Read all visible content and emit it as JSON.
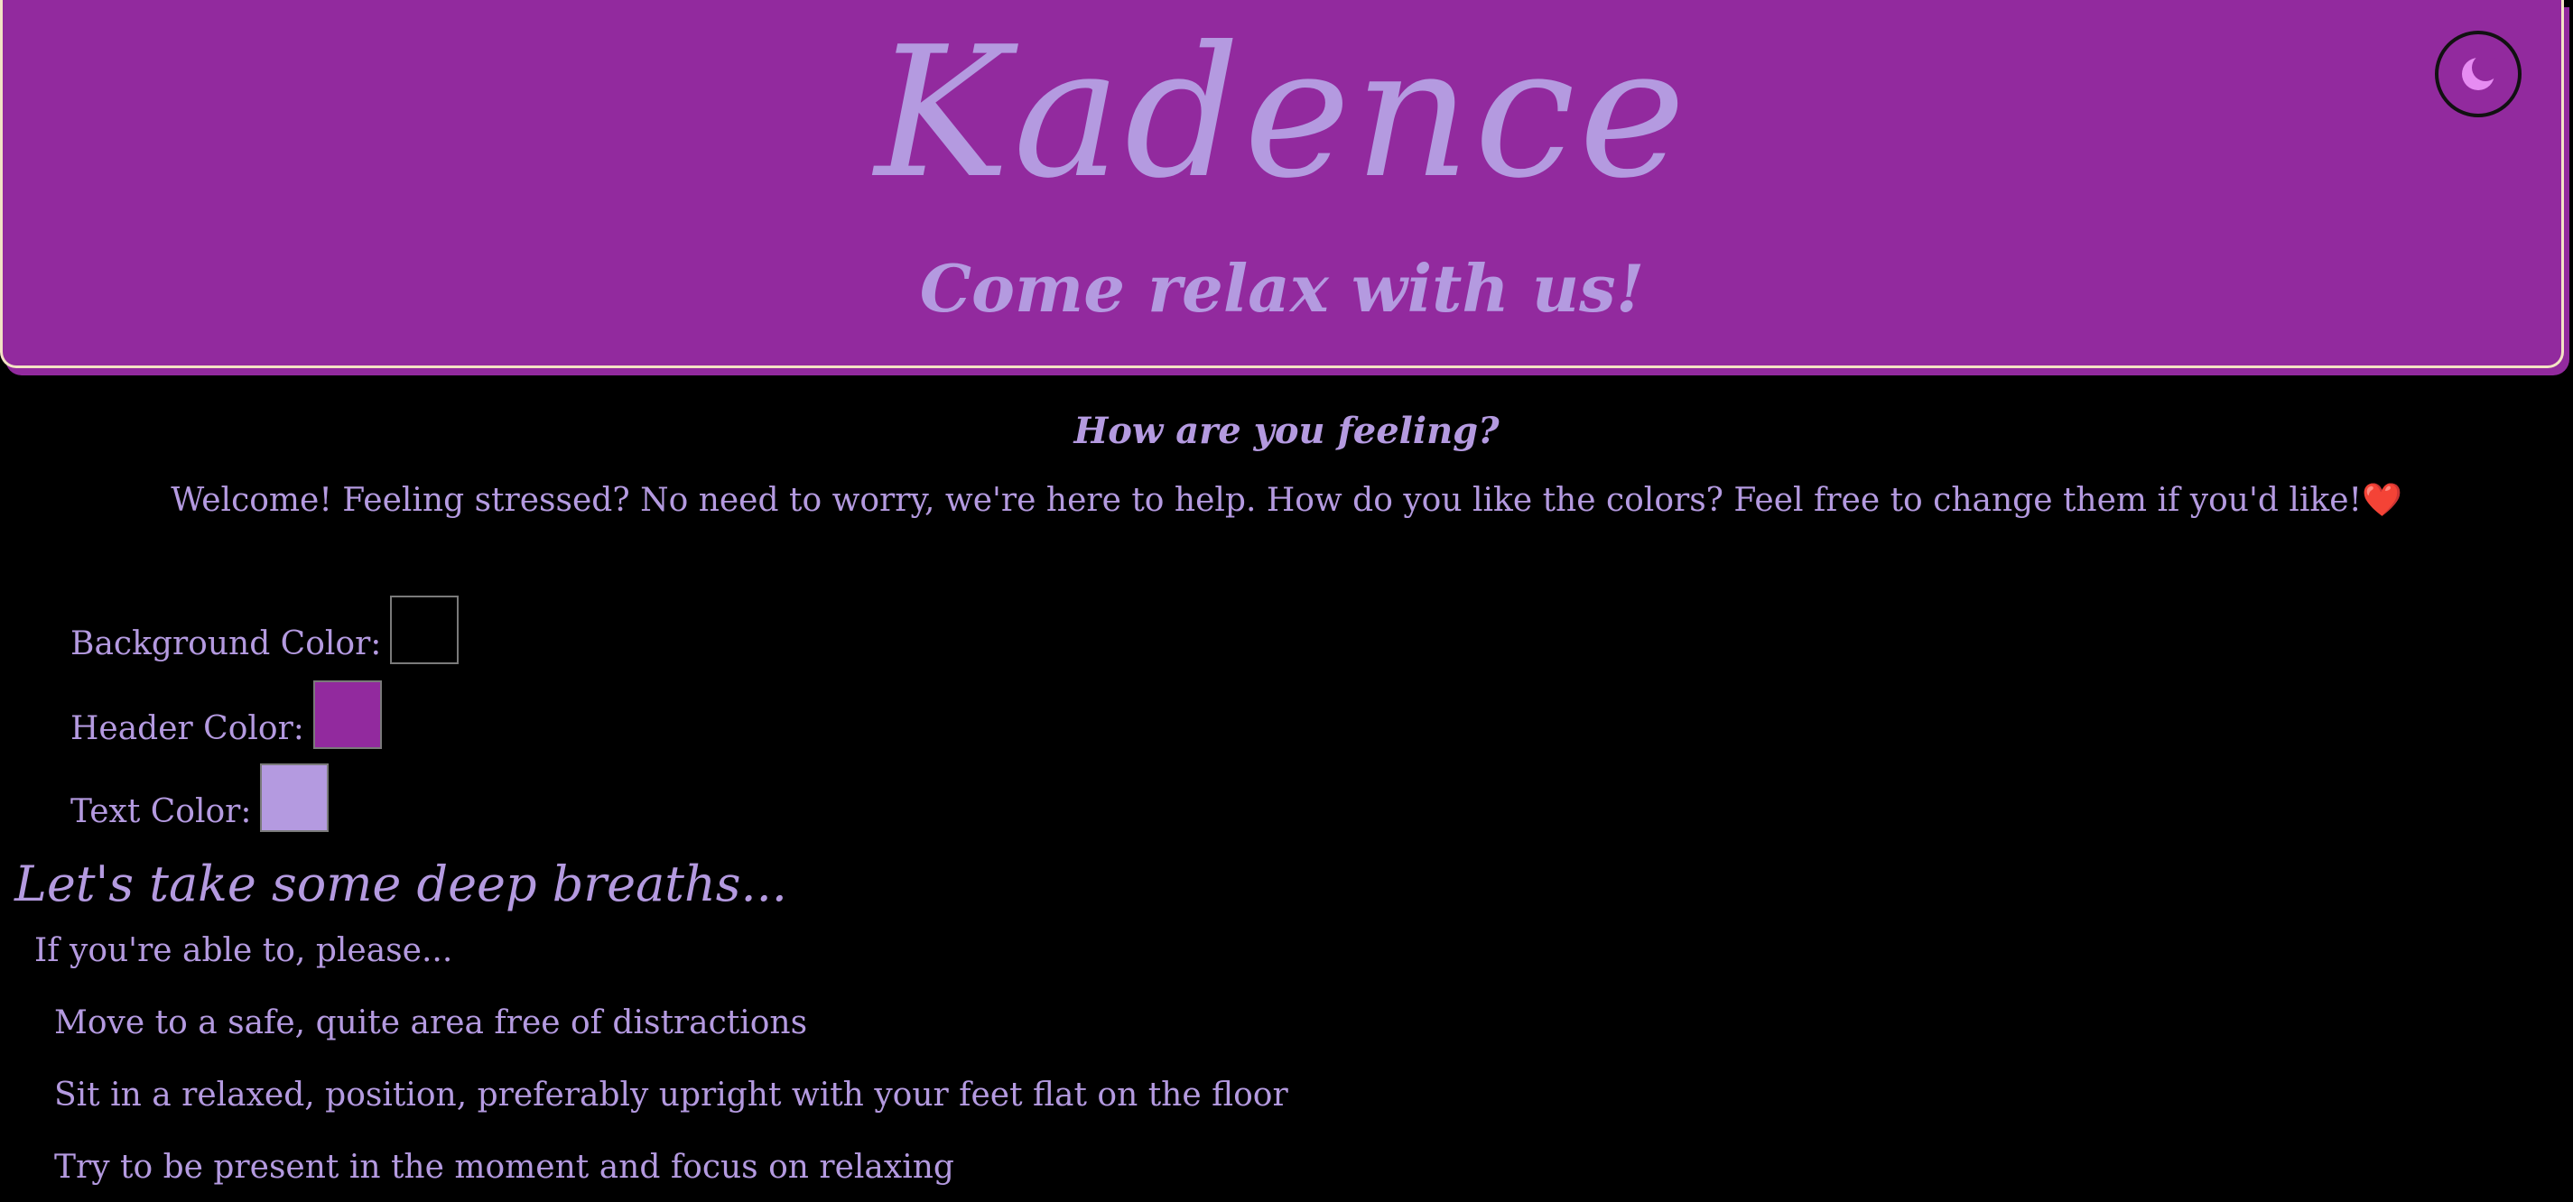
{
  "header": {
    "title": "Kadence",
    "subtitle": "Come relax with us!",
    "theme_toggle_icon": "moon-icon"
  },
  "intro": {
    "question": "How are you feeling?",
    "welcome": "Welcome! Feeling stressed? No need to worry, we're here to help. How do you like the colors? Feel free to change them if you'd like!",
    "heart": "❤️"
  },
  "color_settings": [
    {
      "label": "Background Color:",
      "value": "#000000"
    },
    {
      "label": "Header Color:",
      "value": "#922a9e"
    },
    {
      "label": "Text Color:",
      "value": "#b49ae0"
    }
  ],
  "breathing": {
    "heading": "Let's take some deep breaths...",
    "intro": "If you're able to, please...",
    "steps": [
      "Move to a safe, quite area free of distractions",
      "Sit in a relaxed, position, preferably upright with your feet flat on the floor",
      "Try to be present in the moment and focus on relaxing"
    ]
  },
  "colors": {
    "header_bg": "#922a9e",
    "page_bg": "#000000",
    "text": "#b49ae0",
    "header_border": "#f3e3c4",
    "toggle_icon": "#e68cf2"
  }
}
